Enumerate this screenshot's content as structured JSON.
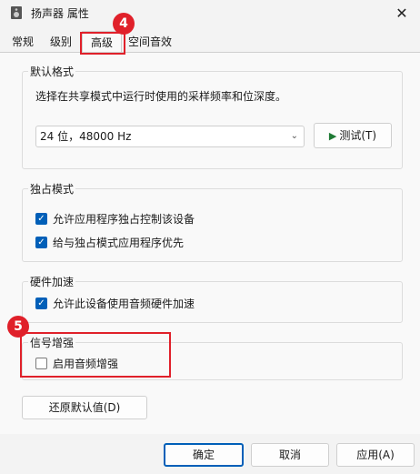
{
  "window": {
    "title": "扬声器 属性",
    "close_icon": "close-icon"
  },
  "tabs": [
    {
      "label": "常规"
    },
    {
      "label": "级别"
    },
    {
      "label": "高级",
      "active": true
    },
    {
      "label": "空间音效"
    }
  ],
  "default_format": {
    "title": "默认格式",
    "description": "选择在共享模式中运行时使用的采样频率和位深度。",
    "selected": "24 位，48000 Hz",
    "test_label": "测试(T)"
  },
  "exclusive_mode": {
    "title": "独占模式",
    "options": [
      {
        "label": "允许应用程序独占控制该设备",
        "checked": true
      },
      {
        "label": "给与独占模式应用程序优先",
        "checked": true
      }
    ]
  },
  "hardware_accel": {
    "title": "硬件加速",
    "option": {
      "label": "允许此设备使用音频硬件加速",
      "checked": true
    }
  },
  "signal_enhance": {
    "title": "信号增强",
    "option": {
      "label": "启用音频增强",
      "checked": false
    }
  },
  "restore_label": "还原默认值(D)",
  "footer": {
    "ok": "确定",
    "cancel": "取消",
    "apply": "应用(A)"
  },
  "annotations": [
    {
      "number": "4"
    },
    {
      "number": "5"
    }
  ],
  "colors": {
    "accent": "#005fb8",
    "annotation": "#e0202a",
    "play": "#1e7a34"
  }
}
